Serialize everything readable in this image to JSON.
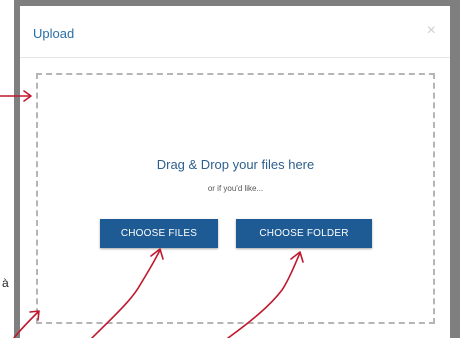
{
  "dialog": {
    "title": "Upload",
    "close_glyph": "×"
  },
  "dropzone": {
    "title": "Drag & Drop your files here",
    "subtitle": "or if you'd like...",
    "choose_files_label": "CHOOSE FILES",
    "choose_folder_label": "CHOOSE FOLDER"
  },
  "edge_text": {
    "left_char": "à"
  },
  "colors": {
    "accent": "#1e5a93",
    "title": "#2a6ea6",
    "annotation_arrow": "#c0192e",
    "backdrop": "#7f7f7f"
  }
}
